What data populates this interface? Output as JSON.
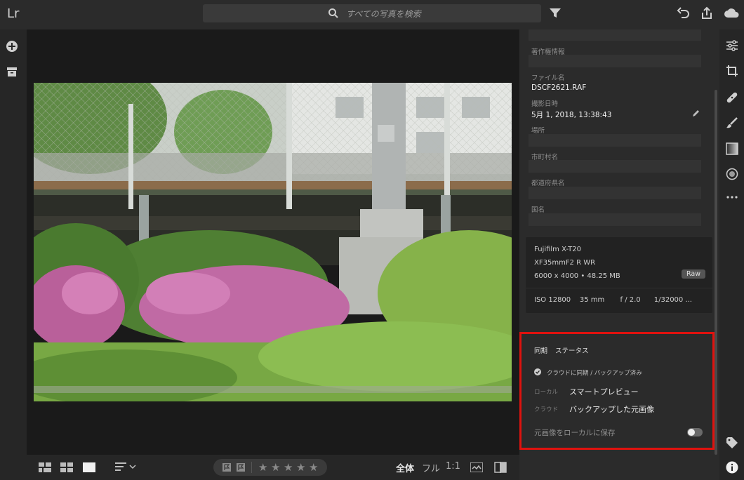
{
  "app": {
    "logo": "Lr"
  },
  "search": {
    "placeholder": "すべての写真を検索"
  },
  "photo_info": {
    "copyright_label": "著作権情報",
    "filename_label": "ファイル名",
    "filename": "DSCF2621.RAF",
    "capture_date_label": "撮影日時",
    "capture_date": "5月 1, 2018, 13:38:43",
    "location_label": "場所",
    "city_label": "市町村名",
    "state_label": "都道府県名",
    "country_label": "国名"
  },
  "camera": {
    "model": "Fujifilm X-T20",
    "lens": "XF35mmF2 R WR",
    "dimensions": "6000 x 4000 • 48.25 MB",
    "format_badge": "Raw",
    "exposure": "ISO 12800    35 mm       f / 2.0      1/32000 ..."
  },
  "sync": {
    "title": "同期",
    "status_label": "ステータス",
    "cloud_status": "クラウドに同期 / バックアップ済み",
    "local_label": "ローカル",
    "local_value": "スマートプレビュー",
    "cloud_label": "クラウド",
    "cloud_value": "バックアップした元画像",
    "save_local_label": "元画像をローカルに保存",
    "save_local_on": false
  },
  "bottom": {
    "zoom_fit": "全体",
    "zoom_full": "フル",
    "zoom_1to1": "1:1",
    "stars": [
      "★",
      "★",
      "★",
      "★",
      "★"
    ]
  },
  "colors": {
    "highlight": "#e0120e",
    "panel": "#2b2b2b"
  },
  "icons": {
    "top": [
      "search-icon",
      "filter-icon",
      "undo-icon",
      "share-icon",
      "cloud-icon"
    ],
    "left": [
      "add-icon",
      "library-icon"
    ],
    "right": [
      "edit-sliders-icon",
      "crop-icon",
      "healing-icon",
      "brush-icon",
      "linear-gradient-icon",
      "radial-gradient-icon",
      "more-icon",
      "tag-icon",
      "info-icon"
    ]
  }
}
